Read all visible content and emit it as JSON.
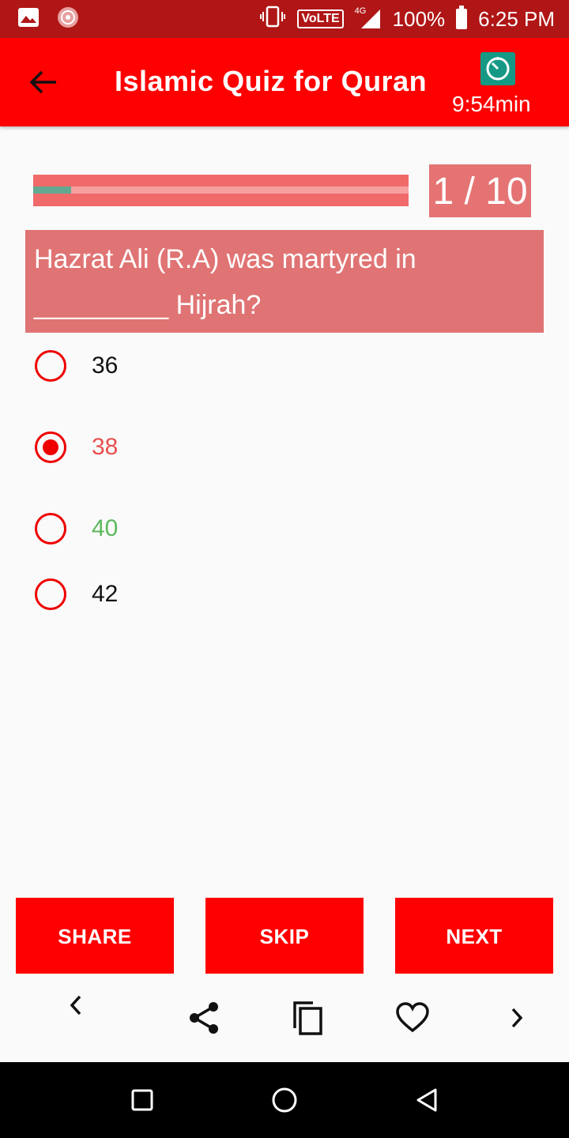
{
  "status_bar": {
    "volte": "VoLTE",
    "network": "4G",
    "battery": "100%",
    "time": "6:25 PM"
  },
  "app_bar": {
    "title": "Islamic Quiz for Quran",
    "timer": "9:54min"
  },
  "quiz": {
    "counter": "1 / 10",
    "progress_fraction": 0.1,
    "question_line1": "Hazrat Ali (R.A) was martyred in",
    "question_line2": "_________ Hijrah?",
    "options": [
      {
        "label": "36",
        "state": "default"
      },
      {
        "label": "38",
        "state": "selected"
      },
      {
        "label": "40",
        "state": "correct"
      },
      {
        "label": "42",
        "state": "default"
      }
    ]
  },
  "actions": {
    "share": "SHARE",
    "skip": "SKIP",
    "next": "NEXT"
  },
  "colors": {
    "status_bar": "#b01616",
    "app_bar": "#ff0000",
    "question_bg": "#e07474",
    "selected_text": "#e85050",
    "correct_text": "#5cb85c",
    "radio": "#ee0000",
    "timer_icon": "#159985"
  },
  "icons": {
    "toolbar": [
      "chevron-left-icon",
      "share-icon",
      "copy-icon",
      "heart-icon",
      "chevron-right-icon"
    ],
    "nav": [
      "recents-icon",
      "home-icon",
      "back-icon"
    ]
  }
}
